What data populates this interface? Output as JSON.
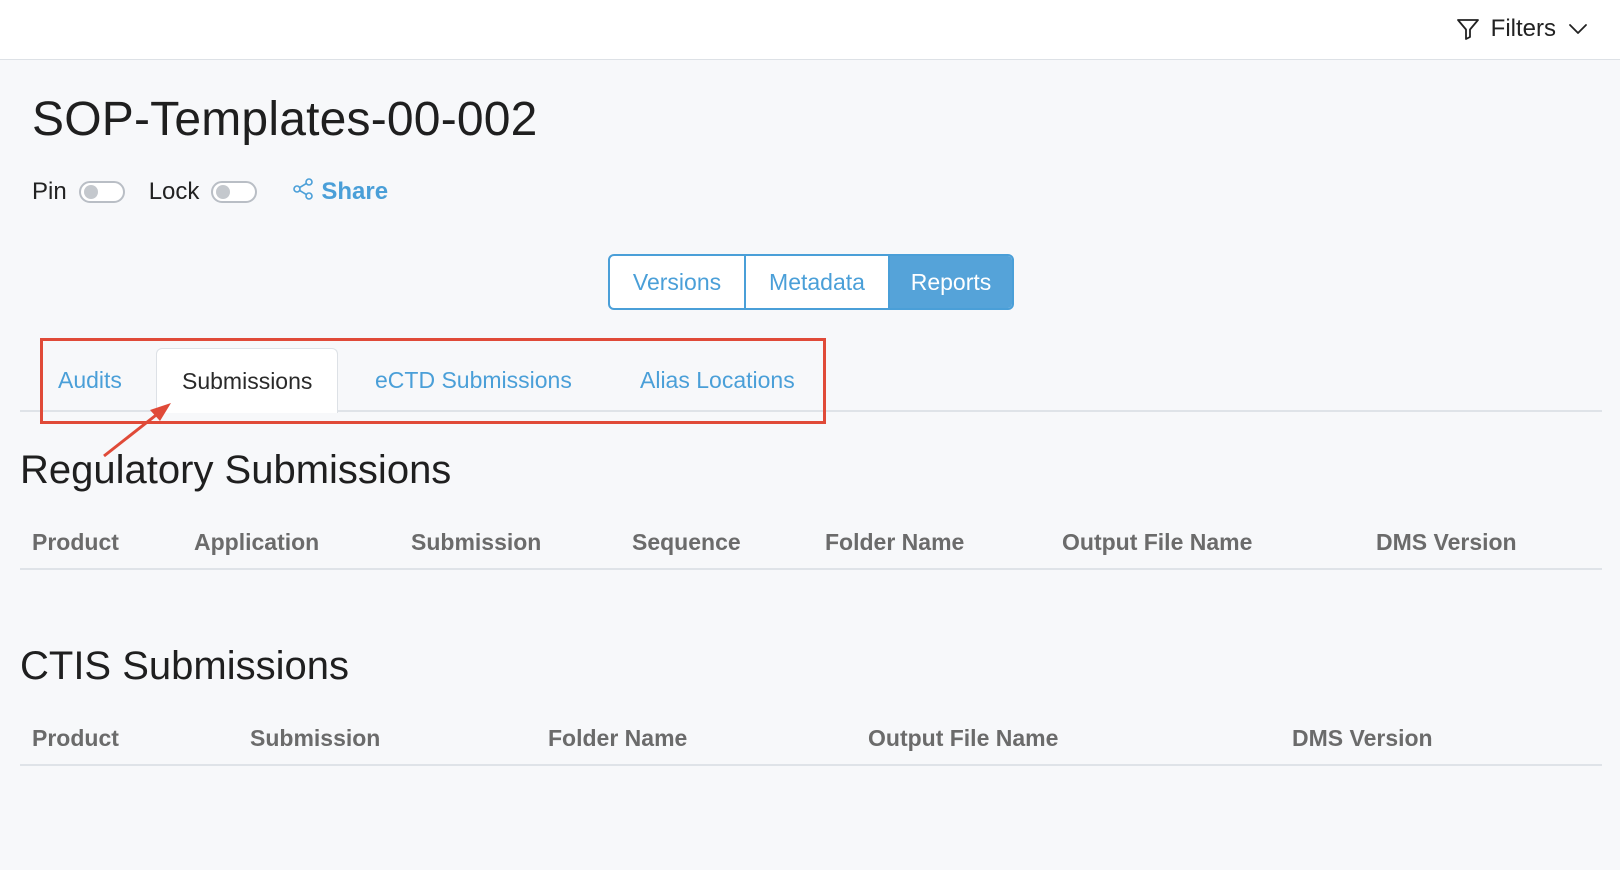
{
  "header": {
    "filters_label": "Filters",
    "filters_icon": "funnel-icon",
    "chevron_icon": "chevron-down-icon"
  },
  "document": {
    "title": "SOP-Templates-00-002"
  },
  "controls": {
    "pin_label": "Pin",
    "lock_label": "Lock",
    "pin_on": false,
    "lock_on": false,
    "share_label": "Share",
    "share_icon": "share-icon"
  },
  "view_tabs": {
    "items": [
      {
        "label": "Versions",
        "active": false
      },
      {
        "label": "Metadata",
        "active": false
      },
      {
        "label": "Reports",
        "active": true
      }
    ]
  },
  "report_tabs": {
    "items": [
      {
        "label": "Audits",
        "active": false
      },
      {
        "label": "Submissions",
        "active": true
      },
      {
        "label": "eCTD Submissions",
        "active": false
      },
      {
        "label": "Alias Locations",
        "active": false
      }
    ]
  },
  "annotation": {
    "highlight_color": "#e04a38"
  },
  "regulatory": {
    "title": "Regulatory Submissions",
    "columns": [
      "Product",
      "Application",
      "Submission",
      "Sequence",
      "Folder Name",
      "Output File Name",
      "DMS Version"
    ]
  },
  "ctis": {
    "title": "CTIS Submissions",
    "columns": [
      "Product",
      "Submission",
      "Folder Name",
      "Output File Name",
      "DMS Version"
    ]
  },
  "colors": {
    "accent": "#4a9fd8",
    "accent_active_bg": "#55a3d9",
    "background": "#f7f8fa"
  }
}
